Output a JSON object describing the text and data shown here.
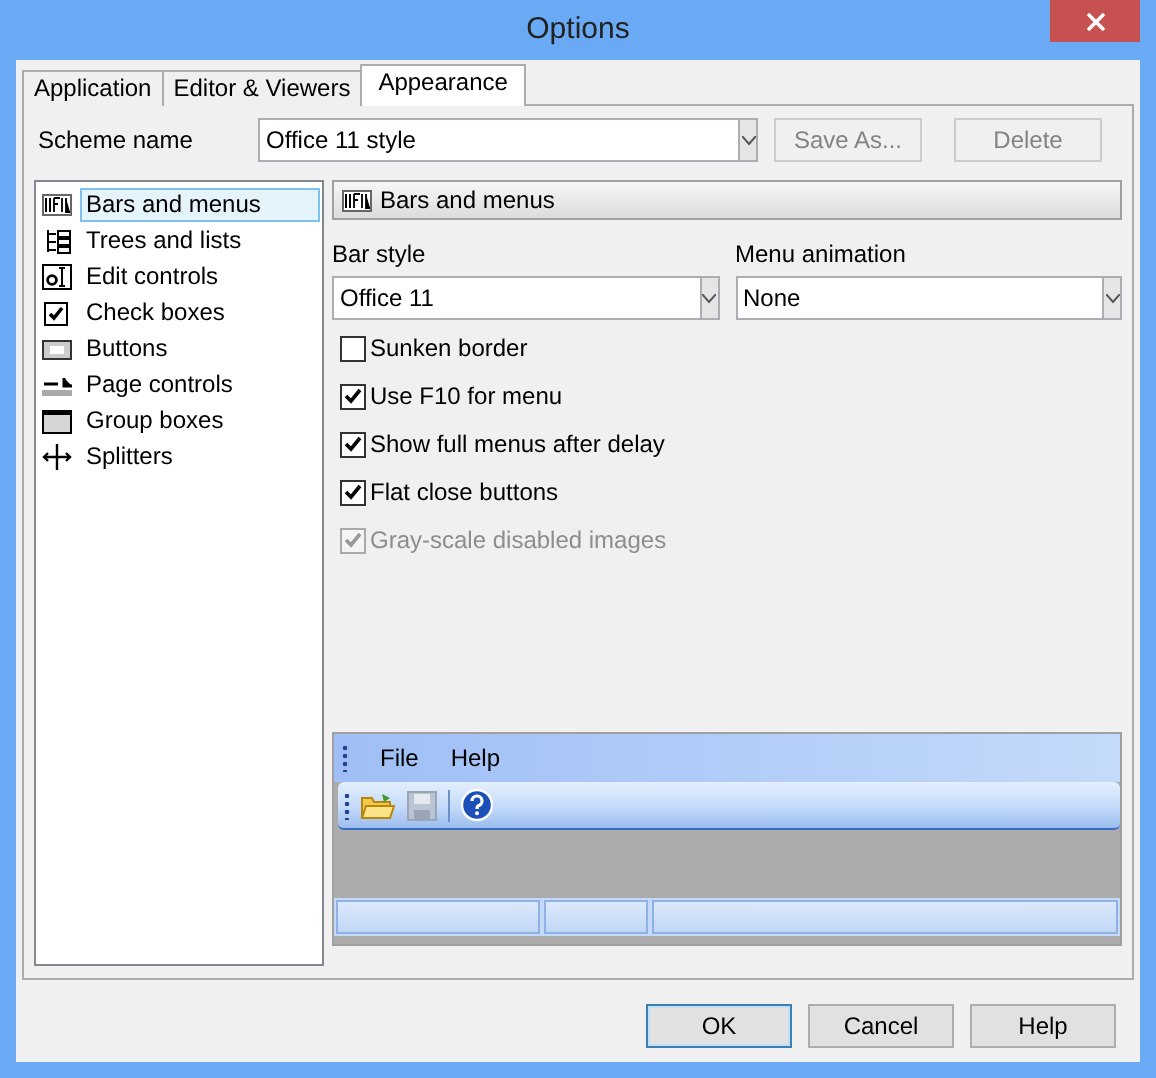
{
  "window": {
    "title": "Options"
  },
  "tabs": [
    {
      "label": "Application",
      "selected": false
    },
    {
      "label": "Editor & Viewers",
      "selected": false
    },
    {
      "label": "Appearance",
      "selected": true
    }
  ],
  "scheme": {
    "label": "Scheme name",
    "value": "Office 11 style",
    "buttons": [
      {
        "label": "Save As...",
        "disabled": true
      },
      {
        "label": "Delete",
        "disabled": true
      }
    ]
  },
  "categories": [
    {
      "label": "Bars and menus",
      "selected": true
    },
    {
      "label": "Trees and lists",
      "selected": false
    },
    {
      "label": "Edit controls",
      "selected": false
    },
    {
      "label": "Check boxes",
      "selected": false
    },
    {
      "label": "Buttons",
      "selected": false
    },
    {
      "label": "Page controls",
      "selected": false
    },
    {
      "label": "Group boxes",
      "selected": false
    },
    {
      "label": "Splitters",
      "selected": false
    }
  ],
  "panel": {
    "title": "Bars and menus",
    "fields": [
      {
        "label": "Bar style",
        "value": "Office 11"
      },
      {
        "label": "Menu animation",
        "value": "None"
      }
    ],
    "checkboxes": [
      {
        "label": "Sunken border",
        "checked": false,
        "disabled": false
      },
      {
        "label": "Use F10 for menu",
        "checked": true,
        "disabled": false
      },
      {
        "label": "Show full menus after delay",
        "checked": true,
        "disabled": false
      },
      {
        "label": "Flat close buttons",
        "checked": true,
        "disabled": false
      },
      {
        "label": "Gray-scale disabled images",
        "checked": true,
        "disabled": true
      }
    ],
    "preview": {
      "menu": [
        "File",
        "Help"
      ]
    }
  },
  "buttons": [
    {
      "label": "OK",
      "default": true
    },
    {
      "label": "Cancel",
      "default": false
    },
    {
      "label": "Help",
      "default": false
    }
  ]
}
